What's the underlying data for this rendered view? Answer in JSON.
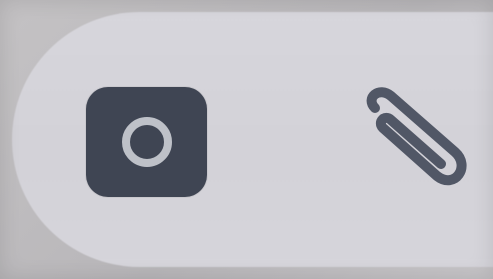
{
  "composer": {
    "camera_button": {
      "icon": "camera-icon",
      "color": "#3f4553",
      "ring_color": "#c9ccd3"
    },
    "attach_button": {
      "icon": "paperclip-icon",
      "color": "#4a5060"
    },
    "bar_color": "#d6d5db"
  }
}
